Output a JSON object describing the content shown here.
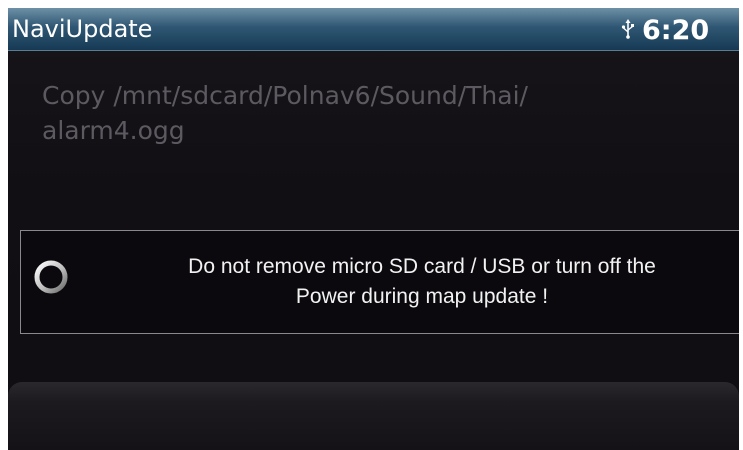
{
  "app": {
    "title": "NaviUpdate"
  },
  "status_bar": {
    "time": "6:20",
    "usb_icon": "usb-icon"
  },
  "progress": {
    "copy_line1": "Copy /mnt/sdcard/Polnav6/Sound/Thai/",
    "copy_line2": "alarm4.ogg"
  },
  "warning": {
    "icon": "spinner-icon",
    "message": "Do not remove micro SD card / USB or turn off  the\nPower during map update !"
  },
  "colors": {
    "title_bar": "#2f5773",
    "background": "#120f14",
    "dim_text": "#5c5a60",
    "text": "#ffffff"
  }
}
